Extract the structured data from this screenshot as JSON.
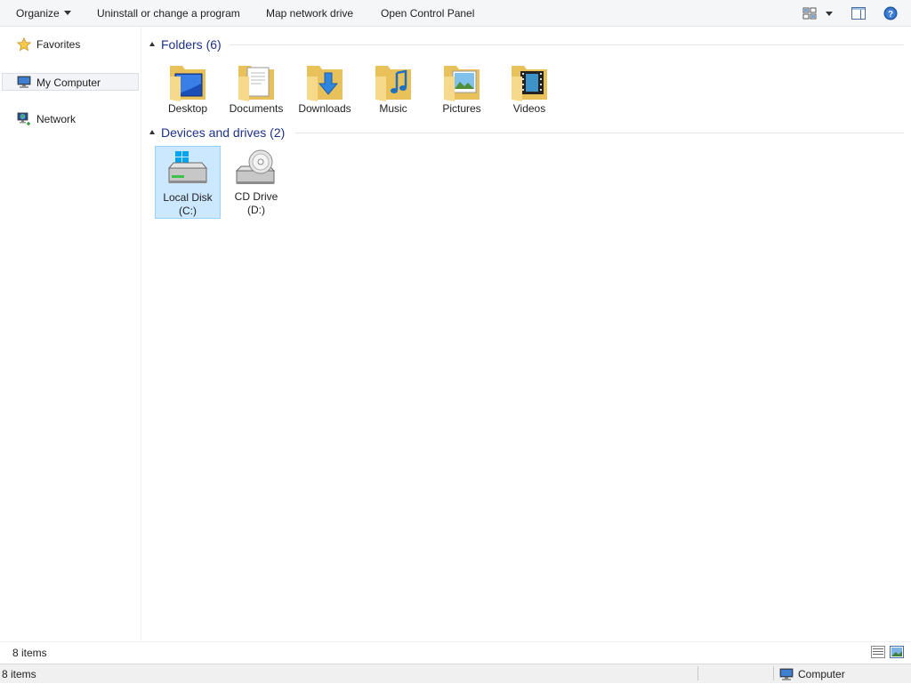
{
  "toolbar": {
    "organize": "Organize",
    "uninstall": "Uninstall or change a program",
    "map_drive": "Map network drive",
    "control_panel": "Open Control Panel",
    "icons": [
      "change-view-icon",
      "view-options-caret-icon",
      "preview-pane-icon",
      "help-icon"
    ]
  },
  "nav": {
    "favorites": "Favorites",
    "my_computer": "My Computer",
    "network": "Network",
    "icons": [
      "star-icon",
      "computer-icon",
      "network-icon"
    ]
  },
  "groups": {
    "folders": {
      "title": "Folders (6)",
      "items": [
        {
          "label": "Desktop",
          "icon": "desktop-folder-icon"
        },
        {
          "label": "Documents",
          "icon": "documents-folder-icon"
        },
        {
          "label": "Downloads",
          "icon": "downloads-folder-icon"
        },
        {
          "label": "Music",
          "icon": "music-folder-icon"
        },
        {
          "label": "Pictures",
          "icon": "pictures-folder-icon"
        },
        {
          "label": "Videos",
          "icon": "videos-folder-icon"
        }
      ]
    },
    "devices": {
      "title": "Devices and drives (2)",
      "items": [
        {
          "label_line1": "Local Disk",
          "label_line2": "(C:)",
          "icon": "local-disk-icon",
          "selected": true
        },
        {
          "label_line1": "CD Drive",
          "label_line2": "(D:)",
          "icon": "cd-drive-icon",
          "selected": false
        }
      ]
    }
  },
  "status": {
    "count_upper": "8 items",
    "count_lower": "8 items",
    "location": "Computer"
  },
  "colors": {
    "group_header": "#1e3287",
    "selection_bg": "#cce8ff",
    "selection_border": "#99d1ff",
    "folder_yellow": "#f5d67a"
  }
}
